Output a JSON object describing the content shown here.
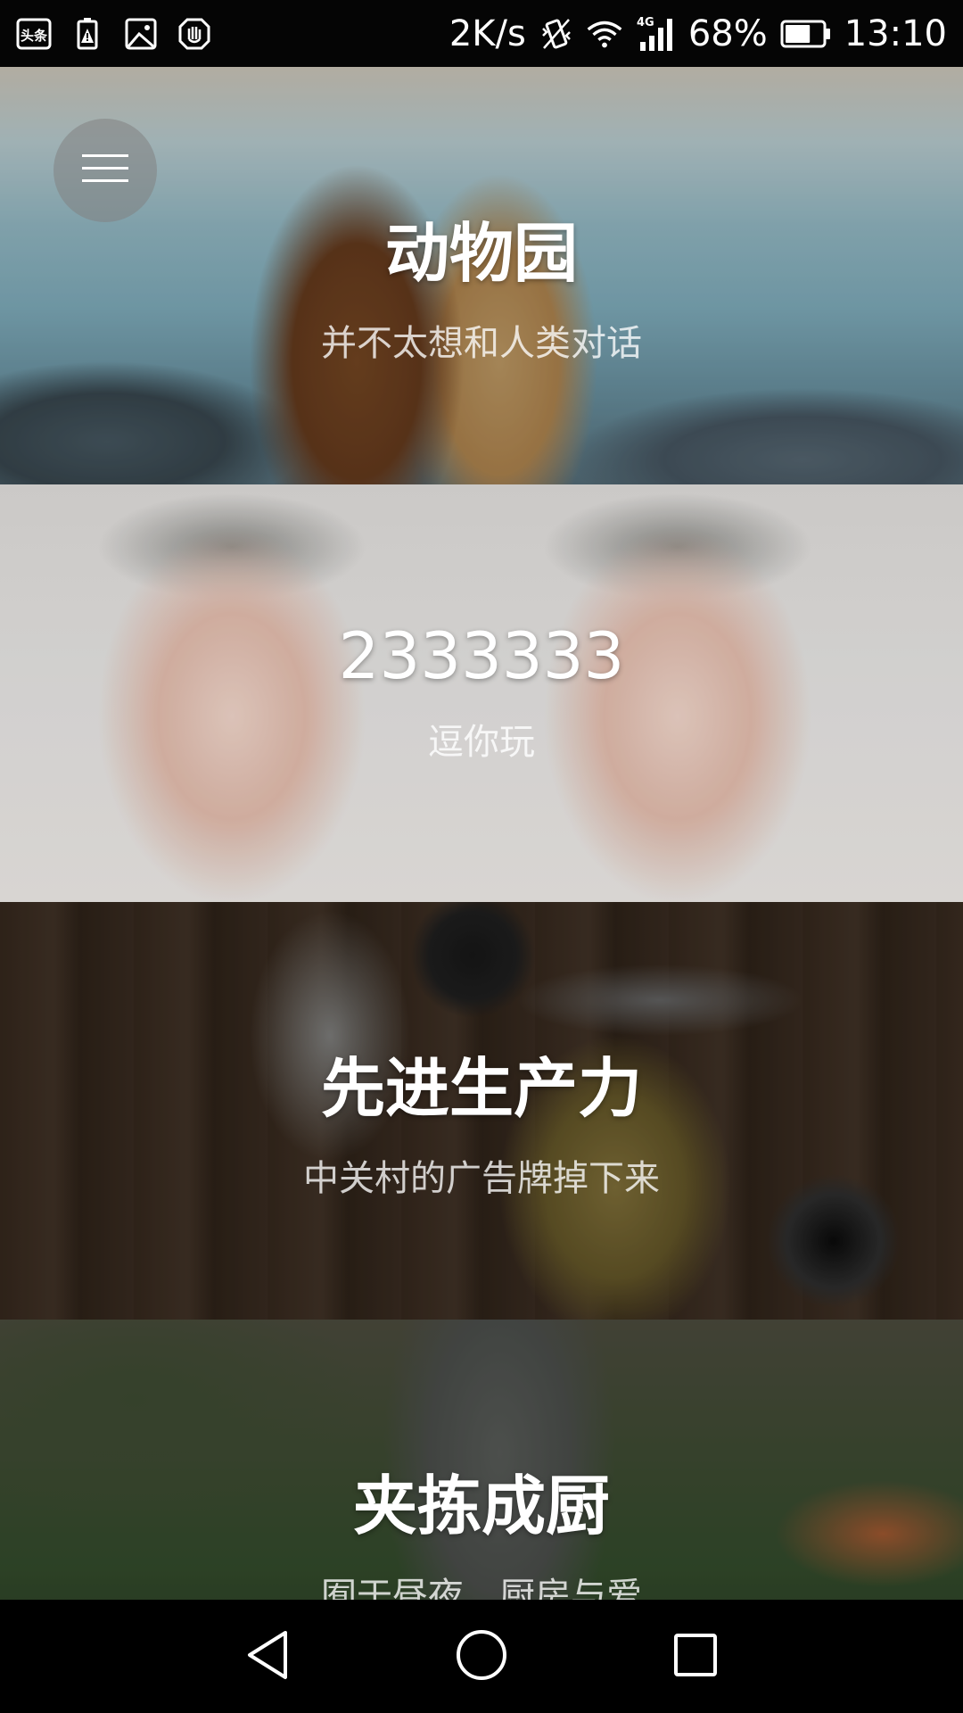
{
  "status_bar": {
    "left_icons": [
      "toutiao-app-icon",
      "battery-alert-icon",
      "image-icon",
      "hand-stop-icon"
    ],
    "toutiao_label": "头条",
    "net_speed": "2K/s",
    "signal_type": "4G",
    "battery_percent": "68%",
    "battery_level": 0.68,
    "time": "13:10"
  },
  "menu": {
    "icon": "hamburger-menu-icon"
  },
  "cards": [
    {
      "title": "动物园",
      "subtitle": "并不太想和人类对话",
      "image": "dogs-on-beach"
    },
    {
      "title": "2333333",
      "subtitle": "逗你玩",
      "image": "two-funny-faces"
    },
    {
      "title": "先进生产力",
      "subtitle": "中关村的广告牌掉下来",
      "image": "tools-on-wood"
    },
    {
      "title": "夹拣成厨",
      "subtitle": "囿于昼夜，厨房与爱",
      "image": "outdoor-cooking"
    }
  ],
  "nav_bar": {
    "back_icon": "back-triangle-icon",
    "home_icon": "home-circle-icon",
    "recents_icon": "recents-square-icon"
  },
  "colors": {
    "status_bar_bg": "#050505",
    "nav_bar_bg": "#000000",
    "text": "#ffffff"
  }
}
